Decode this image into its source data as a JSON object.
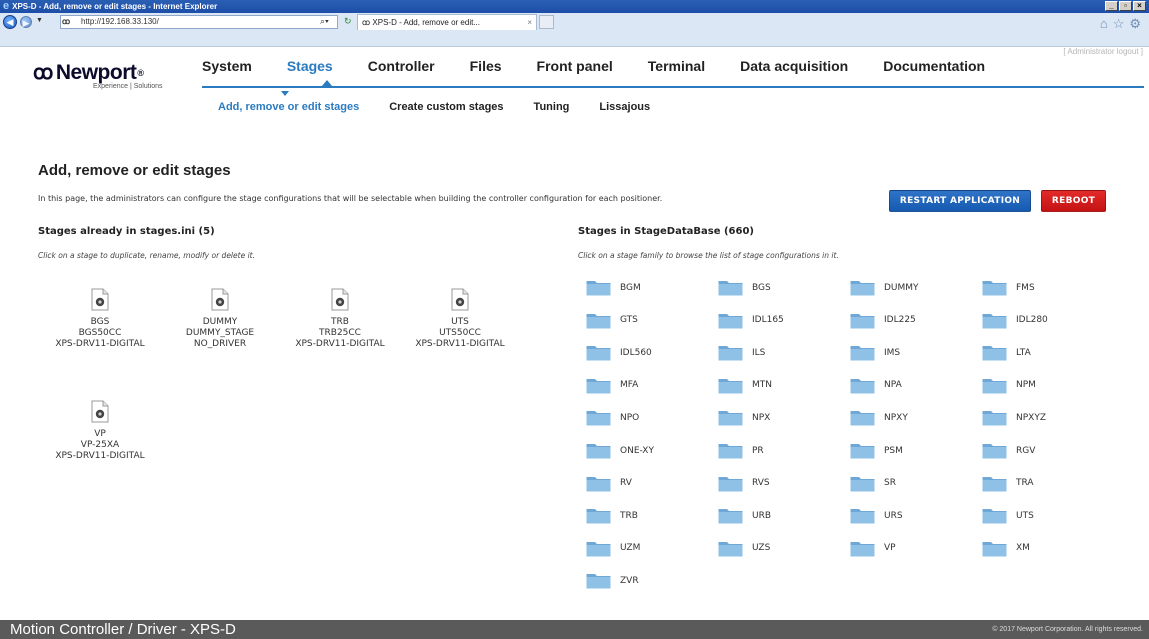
{
  "browser": {
    "window_title": "XPS-D - Add, remove or edit stages - Internet Explorer",
    "address": "http://192.168.33.130/",
    "tab_title": "XPS-D - Add, remove or edit...",
    "logo_mark": "ꝏ"
  },
  "header": {
    "admin_logout": "[ Administrator logout ]",
    "logo_text": "Newport",
    "logo_reg": "®",
    "logo_tagline": "Experience | Solutions",
    "nav": [
      "System",
      "Stages",
      "Controller",
      "Files",
      "Front panel",
      "Terminal",
      "Data acquisition",
      "Documentation"
    ],
    "active_nav": "Stages",
    "subnav": [
      "Add, remove or edit stages",
      "Create custom stages",
      "Tuning",
      "Lissajous"
    ]
  },
  "page": {
    "title": "Add, remove or edit stages",
    "description": "In this page, the administrators can configure the stage configurations that will be selectable when building the controller configuration for each positioner.",
    "restart_label": "RESTART APPLICATION",
    "reboot_label": "REBOOT",
    "restart_color": "#1e64bb",
    "reboot_color": "#d41c1c"
  },
  "stages_ini": {
    "title": "Stages already in stages.ini (5)",
    "hint": "Click on a stage to duplicate, rename, modify or delete it.",
    "items": [
      {
        "name": "BGS",
        "model": "BGS50CC",
        "driver": "XPS-DRV11-DIGITAL"
      },
      {
        "name": "DUMMY",
        "model": "DUMMY_STAGE",
        "driver": "NO_DRIVER"
      },
      {
        "name": "TRB",
        "model": "TRB25CC",
        "driver": "XPS-DRV11-DIGITAL"
      },
      {
        "name": "UTS",
        "model": "UTS50CC",
        "driver": "XPS-DRV11-DIGITAL"
      },
      {
        "name": "VP",
        "model": "VP-25XA",
        "driver": "XPS-DRV11-DIGITAL"
      }
    ]
  },
  "stage_db": {
    "title": "Stages in StageDataBase (660)",
    "hint": "Click on a stage family to browse the list of stage configurations in it.",
    "families": [
      "BGM",
      "BGS",
      "DUMMY",
      "FMS",
      "GTS",
      "IDL165",
      "IDL225",
      "IDL280",
      "IDL560",
      "ILS",
      "IMS",
      "LTA",
      "MFA",
      "MTN",
      "NPA",
      "NPM",
      "NPO",
      "NPX",
      "NPXY",
      "NPXYZ",
      "ONE-XY",
      "PR",
      "PSM",
      "RGV",
      "RV",
      "RVS",
      "SR",
      "TRA",
      "TRB",
      "URB",
      "URS",
      "UTS",
      "UZM",
      "UZS",
      "VP",
      "XM",
      "ZVR"
    ]
  },
  "footer": {
    "title": "Motion Controller / Driver - XPS-D",
    "copyright": "© 2017 Newport Corporation. All rights reserved."
  }
}
